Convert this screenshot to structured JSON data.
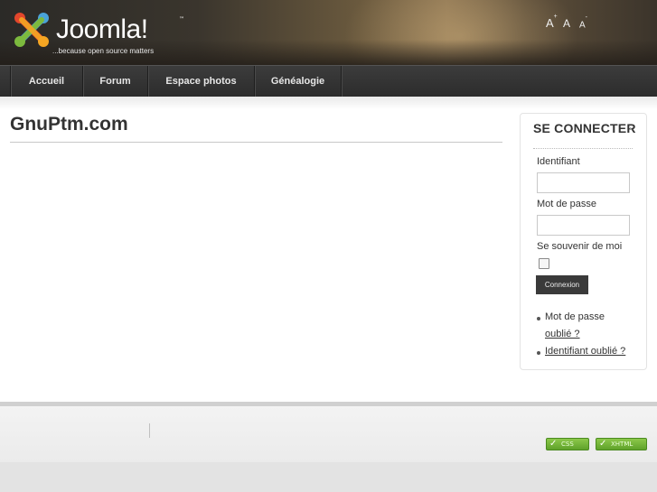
{
  "header": {
    "logo_word": "Joomla!",
    "logo_tm": "™",
    "logo_tagline": "...because open source matters",
    "font_size_controls": {
      "increase_label": "A",
      "increase_sup": "+",
      "reset_label": "A",
      "decrease_label": "A",
      "decrease_sup": "-"
    }
  },
  "nav": {
    "items": [
      {
        "label": "Accueil"
      },
      {
        "label": "Forum"
      },
      {
        "label": "Espace photos"
      },
      {
        "label": "Généalogie"
      }
    ]
  },
  "main": {
    "page_title": "GnuPtm.com"
  },
  "login": {
    "title": "SE CONNECTER",
    "username_label": "Identifiant",
    "username_value": "",
    "password_label": "Mot de passe",
    "password_value": "",
    "remember_label": "Se souvenir de moi",
    "remember_checked": false,
    "submit_label": "Connexion",
    "forgot_password_prefix": "Mot de passe",
    "forgot_password_link": "oublié ?",
    "forgot_username_link": "Identifiant oublié ?"
  },
  "footer": {
    "badge_css": "CSS",
    "badge_xhtml": "XHTML",
    "badge_color": "#6db235"
  }
}
